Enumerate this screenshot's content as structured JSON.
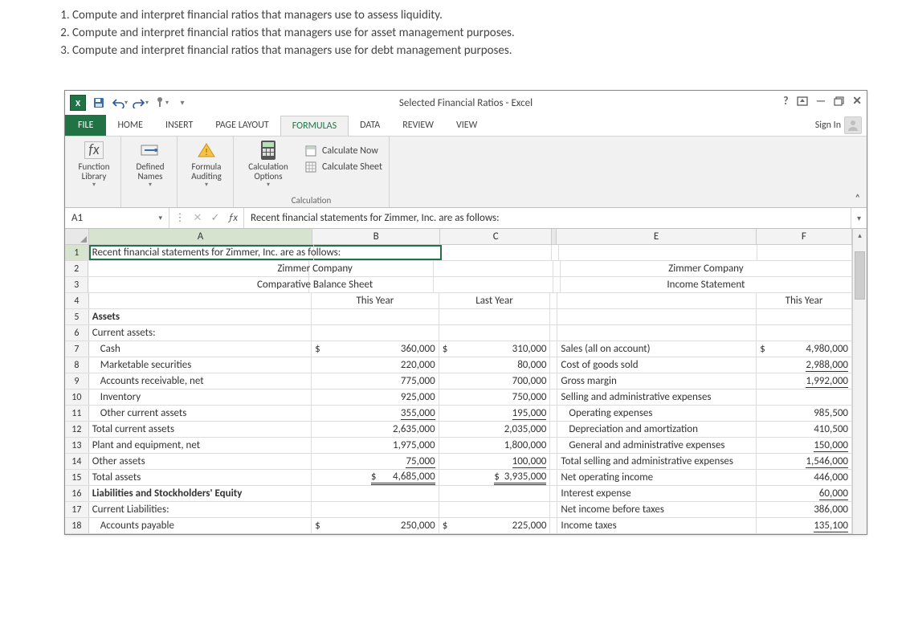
{
  "learning": {
    "items": [
      "Compute and interpret financial ratios that managers use to assess liquidity.",
      "Compute and interpret financial ratios that managers use for asset management purposes.",
      "Compute and interpret financial ratios that managers use for debt management purposes."
    ]
  },
  "titlebar": {
    "title": "Selected Financial Ratios - Excel"
  },
  "tabs": {
    "file": "FILE",
    "home": "HOME",
    "insert": "INSERT",
    "pagelayout": "PAGE LAYOUT",
    "formulas": "FORMULAS",
    "data": "DATA",
    "review": "REVIEW",
    "view": "VIEW",
    "signin": "Sign In"
  },
  "ribbon": {
    "function_library": "Function Library",
    "defined_names": "Defined Names",
    "formula_auditing": "Formula Auditing",
    "calc_options": "Calculation Options",
    "calc_now": "Calculate Now",
    "calc_sheet": "Calculate Sheet",
    "grp_calculation": "Calculation"
  },
  "namebox": "A1",
  "formula_text": "Recent financial statements for Zimmer, Inc. are as follows:",
  "col_headers": {
    "A": "A",
    "B": "B",
    "C": "C",
    "E": "E",
    "F": "F"
  },
  "rows": {
    "r1": {
      "A": "Recent financial statements for Zimmer, Inc. are as follows:"
    },
    "r2": {
      "A_center": "Zimmer Company",
      "E_center": "Zimmer Company"
    },
    "r3": {
      "A_center": "Comparative Balance Sheet",
      "E_center": "Income Statement"
    },
    "r4": {
      "B": "This Year",
      "C": "Last Year",
      "F": "This Year"
    },
    "r5": {
      "A": "Assets"
    },
    "r6": {
      "A": "Current assets:"
    },
    "r7": {
      "A": "Cash",
      "B$": "$",
      "B": "360,000",
      "C$": "$",
      "C": "310,000",
      "E": "Sales (all on account)",
      "F$": "$",
      "F": "4,980,000"
    },
    "r8": {
      "A": "Marketable securities",
      "B": "220,000",
      "C": "80,000",
      "E": "Cost of goods sold",
      "F": "2,988,000",
      "Funder": true
    },
    "r9": {
      "A": "Accounts receivable, net",
      "B": "775,000",
      "C": "700,000",
      "E": "Gross margin",
      "F": "1,992,000",
      "Funder": true
    },
    "r10": {
      "A": "Inventory",
      "B": "925,000",
      "C": "750,000",
      "E": "Selling and administrative expenses"
    },
    "r11": {
      "A": "Other current assets",
      "B": "355,000",
      "C": "195,000",
      "E": "Operating expenses",
      "F": "985,500",
      "BCunder": true
    },
    "r12": {
      "A": "Total current assets",
      "B": "2,635,000",
      "C": "2,035,000",
      "E": "Depreciation and amortization",
      "F": "410,500"
    },
    "r13": {
      "A": "Plant and equipment, net",
      "B": "1,975,000",
      "C": "1,800,000",
      "E": "General and administrative expenses",
      "F": "150,000",
      "Funder": true
    },
    "r14": {
      "A": "Other assets",
      "B": "75,000",
      "C": "100,000",
      "E": "Total selling and administrative expenses",
      "F": "1,546,000",
      "BCunder": true,
      "Funder": true
    },
    "r15": {
      "A": "Total assets",
      "B$": "$",
      "B": "4,685,000",
      "C$": "$",
      "C": "3,935,000",
      "E": "Net operating income",
      "F": "446,000",
      "BCdouble": true
    },
    "r16": {
      "A": "Liabilities and Stockholders' Equity",
      "E": "Interest expense",
      "F": "60,000",
      "Funder": true
    },
    "r17": {
      "A": "Current Liabilities:",
      "E": "Net income before taxes",
      "F": "386,000"
    },
    "r18": {
      "A": "Accounts payable",
      "B$": "$",
      "B": "250,000",
      "C$": "$",
      "C": "225,000",
      "E": "Income taxes",
      "F": "135,100",
      "Funder": true
    }
  }
}
